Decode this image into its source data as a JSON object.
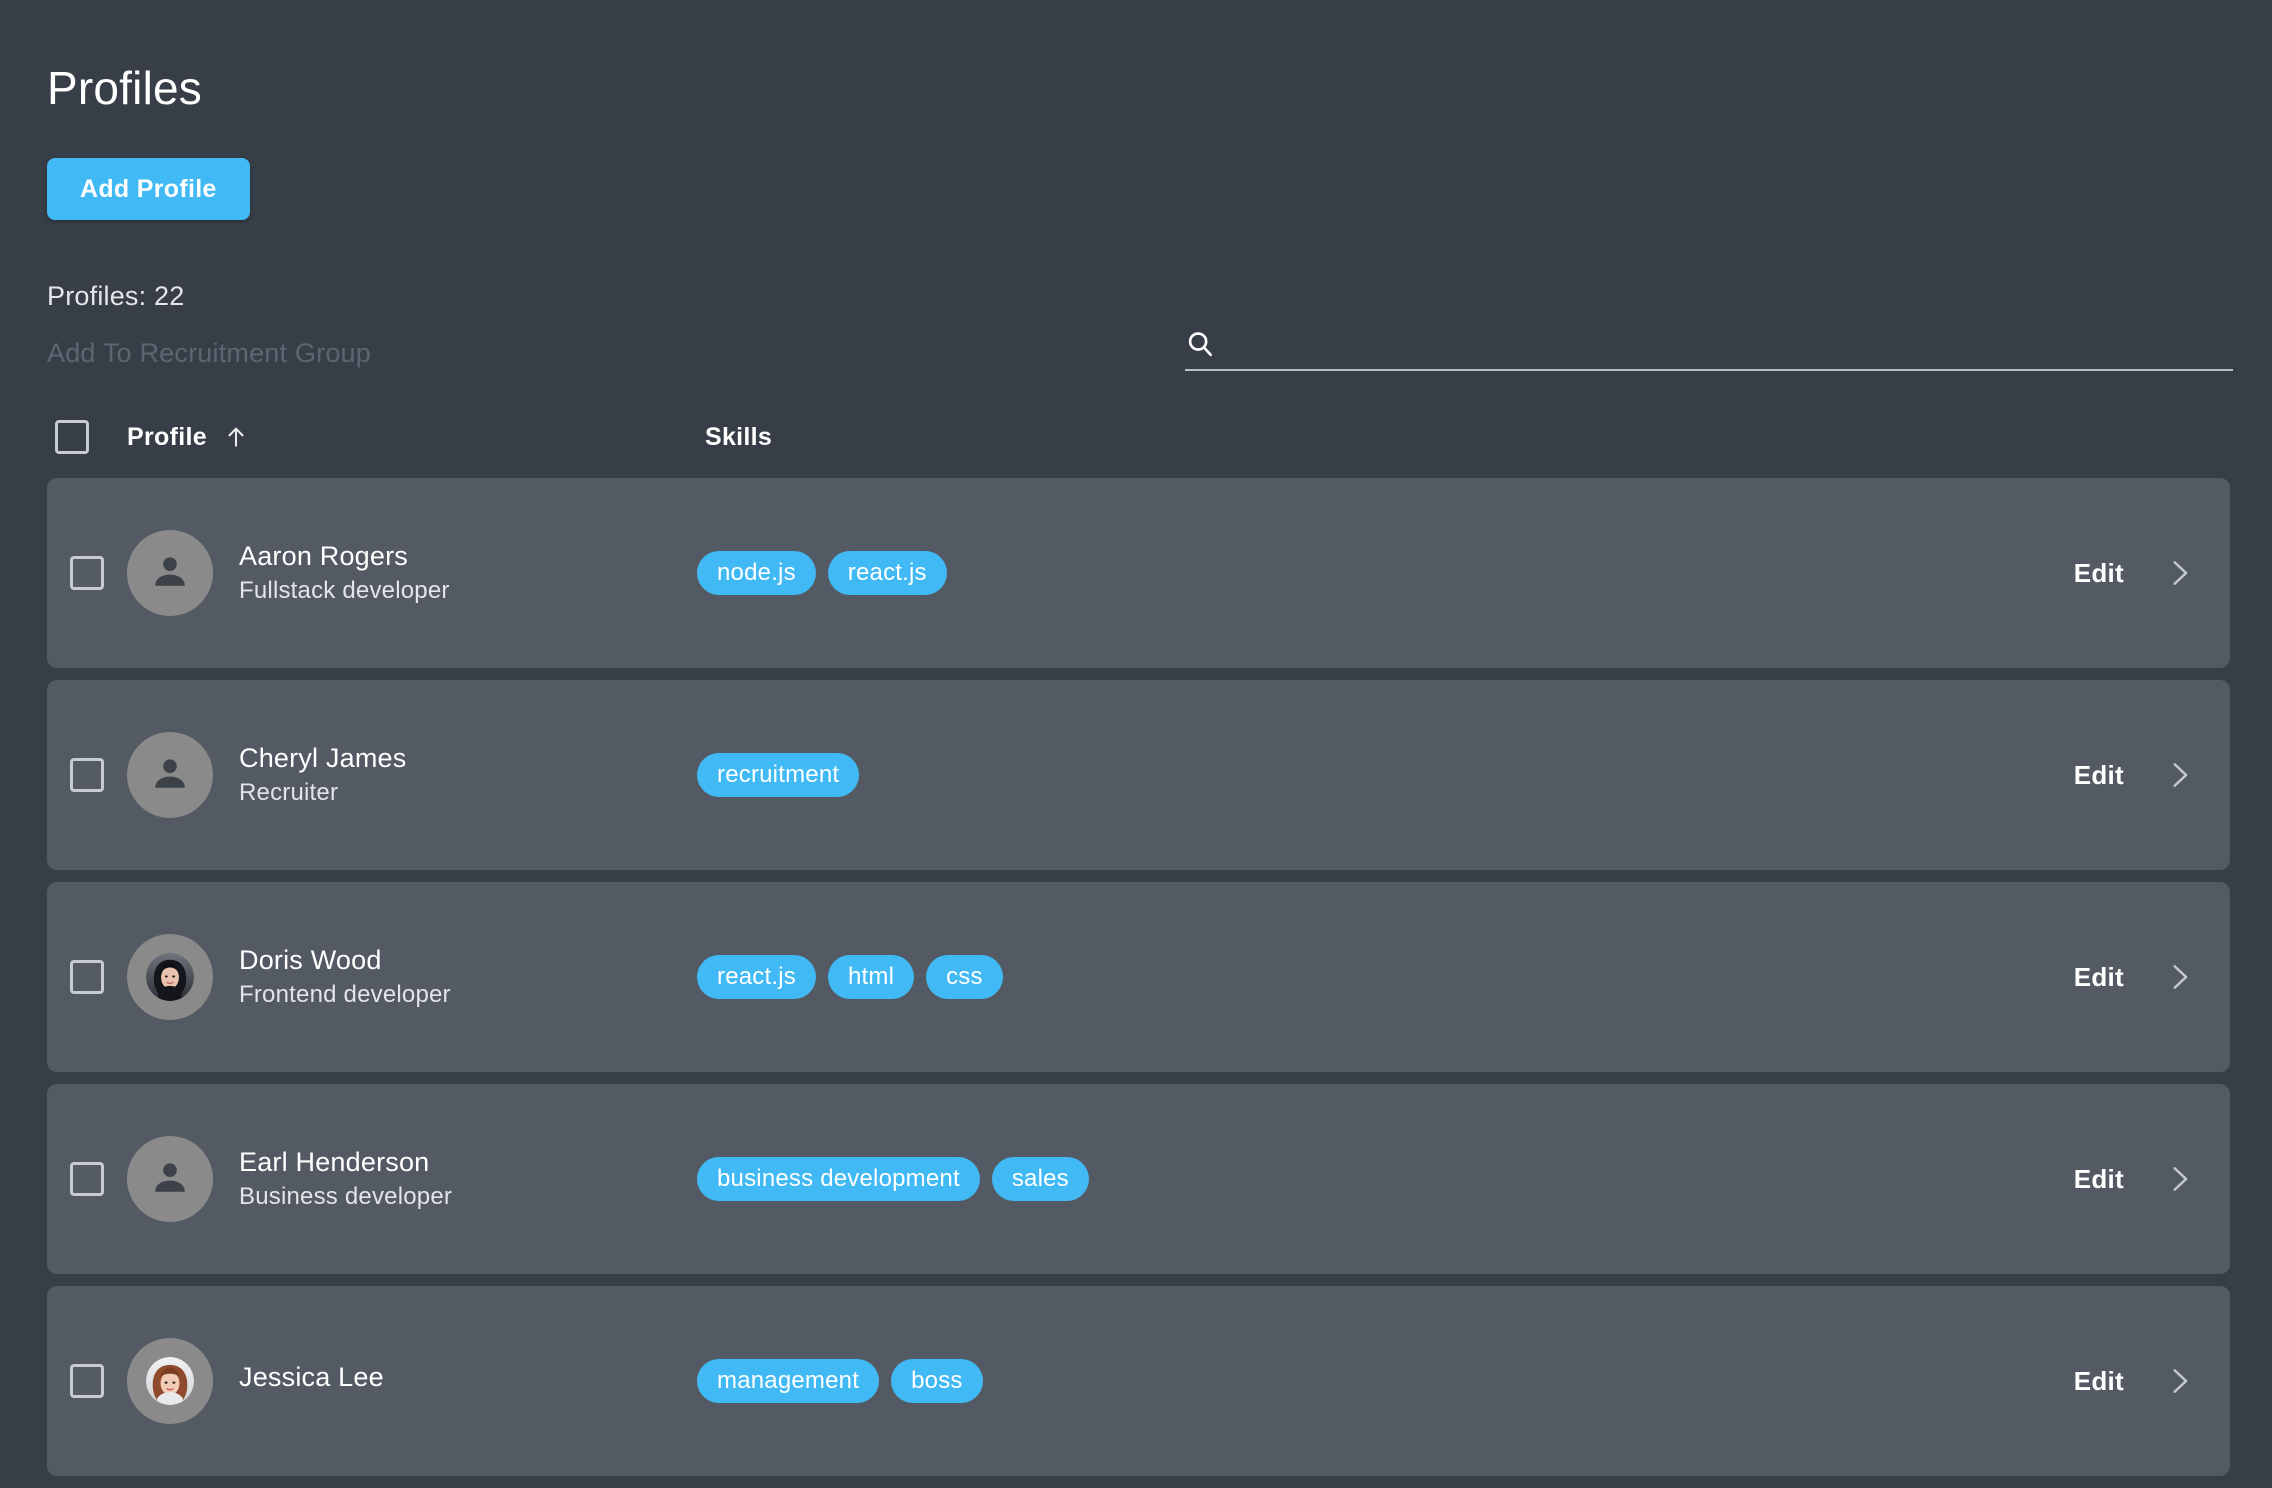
{
  "header": {
    "title": "Profiles",
    "add_profile_label": "Add Profile"
  },
  "toolbar": {
    "profiles_count_text": "Profiles: 22",
    "recruitment_group_label": "Add To Recruitment Group",
    "search_placeholder": "",
    "search_value": "",
    "search_icon": "search-icon"
  },
  "table": {
    "columns": {
      "profile": "Profile",
      "skills": "Skills"
    },
    "sort": {
      "column": "Profile",
      "direction": "ascending",
      "icon": "arrow-up-icon"
    },
    "select_all_checked": false
  },
  "colors": {
    "page_background": "#373e47",
    "row_background": "#545a63",
    "accent": "#40b9f5",
    "muted_text": "#5d6670",
    "avatar_placeholder": "#8a8a8a"
  },
  "rows": [
    {
      "checked": false,
      "avatar_type": "placeholder",
      "avatar_icon": "person-icon",
      "name": "Aaron Rogers",
      "role": "Fullstack developer",
      "skills": [
        "node.js",
        "react.js"
      ],
      "edit_label": "Edit",
      "chevron_icon": "chevron-right-icon"
    },
    {
      "checked": false,
      "avatar_type": "placeholder",
      "avatar_icon": "person-icon",
      "name": "Cheryl James",
      "role": "Recruiter",
      "skills": [
        "recruitment"
      ],
      "edit_label": "Edit",
      "chevron_icon": "chevron-right-icon"
    },
    {
      "checked": false,
      "avatar_type": "photo",
      "avatar_icon": "avatar-photo",
      "name": "Doris Wood",
      "role": "Frontend developer",
      "skills": [
        "react.js",
        "html",
        "css"
      ],
      "edit_label": "Edit",
      "chevron_icon": "chevron-right-icon"
    },
    {
      "checked": false,
      "avatar_type": "placeholder",
      "avatar_icon": "person-icon",
      "name": "Earl Henderson",
      "role": "Business developer",
      "skills": [
        "business development",
        "sales"
      ],
      "edit_label": "Edit",
      "chevron_icon": "chevron-right-icon"
    },
    {
      "checked": false,
      "avatar_type": "photo",
      "avatar_icon": "avatar-photo",
      "name": "Jessica Lee",
      "role": "",
      "skills": [
        "management",
        "boss"
      ],
      "edit_label": "Edit",
      "chevron_icon": "chevron-right-icon"
    }
  ]
}
